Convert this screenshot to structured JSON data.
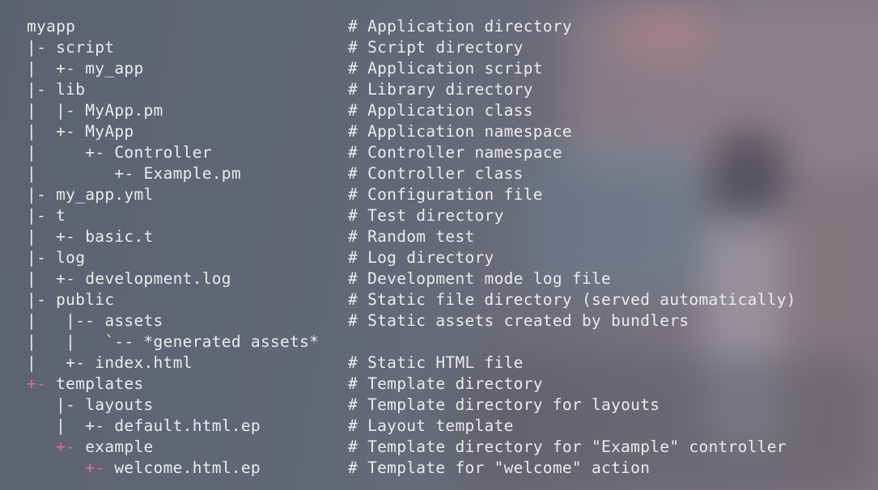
{
  "colors": {
    "background": "#646978",
    "text": "#ececec",
    "highlight_marker": "#e06c9f"
  },
  "tree_rows": [
    {
      "prefix": "",
      "marker": "",
      "name": "myapp",
      "comment": "# Application directory"
    },
    {
      "prefix": "|- ",
      "marker": "",
      "name": "script",
      "comment": "# Script directory"
    },
    {
      "prefix": "|  +- ",
      "marker": "",
      "name": "my_app",
      "comment": "# Application script"
    },
    {
      "prefix": "|- ",
      "marker": "",
      "name": "lib",
      "comment": "# Library directory"
    },
    {
      "prefix": "|  |- ",
      "marker": "",
      "name": "MyApp.pm",
      "comment": "# Application class"
    },
    {
      "prefix": "|  +- ",
      "marker": "",
      "name": "MyApp",
      "comment": "# Application namespace"
    },
    {
      "prefix": "|     +- ",
      "marker": "",
      "name": "Controller",
      "comment": "# Controller namespace"
    },
    {
      "prefix": "|        +- ",
      "marker": "",
      "name": "Example.pm",
      "comment": "# Controller class"
    },
    {
      "prefix": "|- ",
      "marker": "",
      "name": "my_app.yml",
      "comment": "# Configuration file"
    },
    {
      "prefix": "|- ",
      "marker": "",
      "name": "t",
      "comment": "# Test directory"
    },
    {
      "prefix": "|  +- ",
      "marker": "",
      "name": "basic.t",
      "comment": "# Random test"
    },
    {
      "prefix": "|- ",
      "marker": "",
      "name": "log",
      "comment": "# Log directory"
    },
    {
      "prefix": "|  +- ",
      "marker": "",
      "name": "development.log",
      "comment": "# Development mode log file"
    },
    {
      "prefix": "|- ",
      "marker": "",
      "name": "public",
      "comment": "# Static file directory (served automatically)"
    },
    {
      "prefix": "|   |-- ",
      "marker": "",
      "name": "assets",
      "comment": "# Static assets created by bundlers"
    },
    {
      "prefix": "|   |   `-- ",
      "marker": "",
      "name": "*generated assets*",
      "comment": ""
    },
    {
      "prefix": "|   +- ",
      "marker": "",
      "name": "index.html",
      "comment": "# Static HTML file"
    },
    {
      "prefix": "",
      "marker": "+- ",
      "name": "templates",
      "comment": "# Template directory"
    },
    {
      "prefix": "   |- ",
      "marker": "",
      "name": "layouts",
      "comment": "# Template directory for layouts"
    },
    {
      "prefix": "   |  +- ",
      "marker": "",
      "name": "default.html.ep",
      "comment": "# Layout template"
    },
    {
      "prefix": "   ",
      "marker": "+- ",
      "name": "example",
      "comment": "# Template directory for \"Example\" controller"
    },
    {
      "prefix": "      ",
      "marker": "+- ",
      "name": "welcome.html.ep",
      "comment": "# Template for \"welcome\" action"
    }
  ]
}
